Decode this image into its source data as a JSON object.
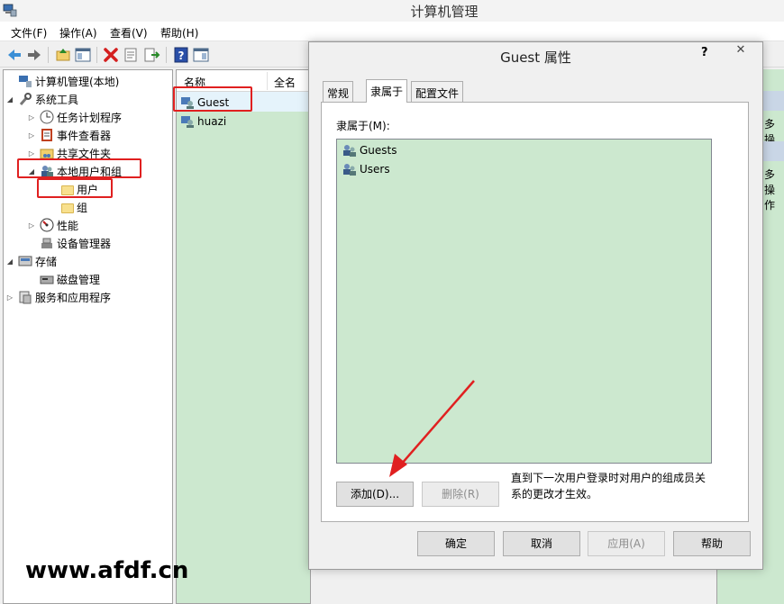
{
  "window": {
    "title": "计算机管理"
  },
  "menu": [
    "文件(F)",
    "操作(A)",
    "查看(V)",
    "帮助(H)"
  ],
  "toolbar_icons": [
    "back-arrow",
    "forward-arrow",
    "up-folder",
    "show-hide-tree",
    "delete-x",
    "properties",
    "export-list",
    "help",
    "show-hide-action"
  ],
  "tree": {
    "root": "计算机管理(本地)",
    "system_tools": "系统工具",
    "task_scheduler": "任务计划程序",
    "event_viewer": "事件查看器",
    "shared_folders": "共享文件夹",
    "local_users_groups": "本地用户和组",
    "users": "用户",
    "groups": "组",
    "performance": "性能",
    "device_manager": "设备管理器",
    "storage": "存储",
    "disk_management": "磁盘管理",
    "services_apps": "服务和应用程序"
  },
  "list": {
    "col_name": "名称",
    "col_fullname": "全名",
    "rows": [
      "Guest",
      "huazi"
    ]
  },
  "action_pane": {
    "text1": "多操作",
    "text2": "多操作"
  },
  "dialog": {
    "title": "Guest 属性",
    "help": "?",
    "close": "✕",
    "tabs": [
      "常规",
      "隶属于",
      "配置文件"
    ],
    "memberof_label": "隶属于(M):",
    "members": [
      "Guests",
      "Users"
    ],
    "add_button": "添加(D)...",
    "remove_button": "删除(R)",
    "note_line1": "直到下一次用户登录时对用户的组成员关",
    "note_line2": "系的更改才生效。",
    "ok": "确定",
    "cancel": "取消",
    "apply": "应用(A)",
    "help_button": "帮助"
  },
  "watermark": "www.afdf.cn",
  "colors": {
    "highlight_red": "#e02020",
    "eye_green": "#cce8cf"
  }
}
